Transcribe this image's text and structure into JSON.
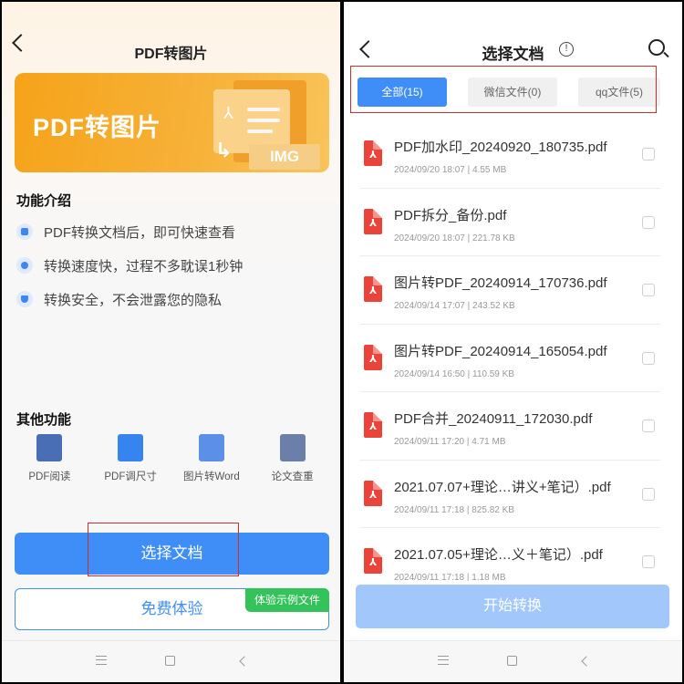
{
  "left": {
    "header": {
      "title": "PDF转图片"
    },
    "banner": {
      "title": "PDF转图片",
      "badge": "IMG"
    },
    "intro": {
      "title": "功能介绍",
      "features": [
        {
          "icon": "search-doc-icon",
          "text": "PDF转换文档后，即可快速查看"
        },
        {
          "icon": "speed-icon",
          "text": "转换速度快，过程不多耽误1秒钟"
        },
        {
          "icon": "shield-icon",
          "text": "转换安全，不会泄露您的隐私"
        }
      ]
    },
    "others": {
      "title": "其他功能",
      "items": [
        {
          "icon": "book-icon",
          "label": "PDF阅读",
          "color": "#4a6eb5"
        },
        {
          "icon": "resize-icon",
          "label": "PDF调尺寸",
          "color": "#3584f0"
        },
        {
          "icon": "image-word-icon",
          "label": "图片转Word",
          "color": "#5b8fe8"
        },
        {
          "icon": "paper-check-icon",
          "label": "论文查重",
          "color": "#6b7fa8"
        }
      ]
    },
    "buttons": {
      "select": "选择文档",
      "trial": "免费体验",
      "demo": "体验示例文件"
    }
  },
  "right": {
    "header": {
      "title": "选择文档"
    },
    "tabs": [
      {
        "label": "全部(15)",
        "active": true
      },
      {
        "label": "微信文件(0)",
        "active": false
      },
      {
        "label": "qq文件(5)",
        "active": false
      }
    ],
    "files": [
      {
        "name": "PDF加水印_20240920_180735.pdf",
        "date": "2024/09/20 18:07",
        "size": "4.55 MB"
      },
      {
        "name": "PDF拆分_备份.pdf",
        "date": "2024/09/20 18:07",
        "size": "221.78 KB"
      },
      {
        "name": "图片转PDF_20240914_170736.pdf",
        "date": "2024/09/14 17:07",
        "size": "243.52 KB"
      },
      {
        "name": "图片转PDF_20240914_165054.pdf",
        "date": "2024/09/14 16:50",
        "size": "110.59 KB"
      },
      {
        "name": "PDF合并_20240911_172030.pdf",
        "date": "2024/09/11 17:20",
        "size": "4.71 MB"
      },
      {
        "name": "2021.07.07+理论…讲义+笔记）.pdf",
        "date": "2024/09/11 17:18",
        "size": "825.82 KB"
      },
      {
        "name": "2021.07.05+理论…义＋笔记）.pdf",
        "date": "2024/09/11 17:18",
        "size": "1.18 MB"
      }
    ],
    "start_button": "开始转换"
  },
  "colors": {
    "accent": "#3f8ef7",
    "banner": "#f5a319",
    "pdf_red": "#e9433a",
    "demo_green": "#34c25a",
    "highlight_box": "#c9302c"
  }
}
